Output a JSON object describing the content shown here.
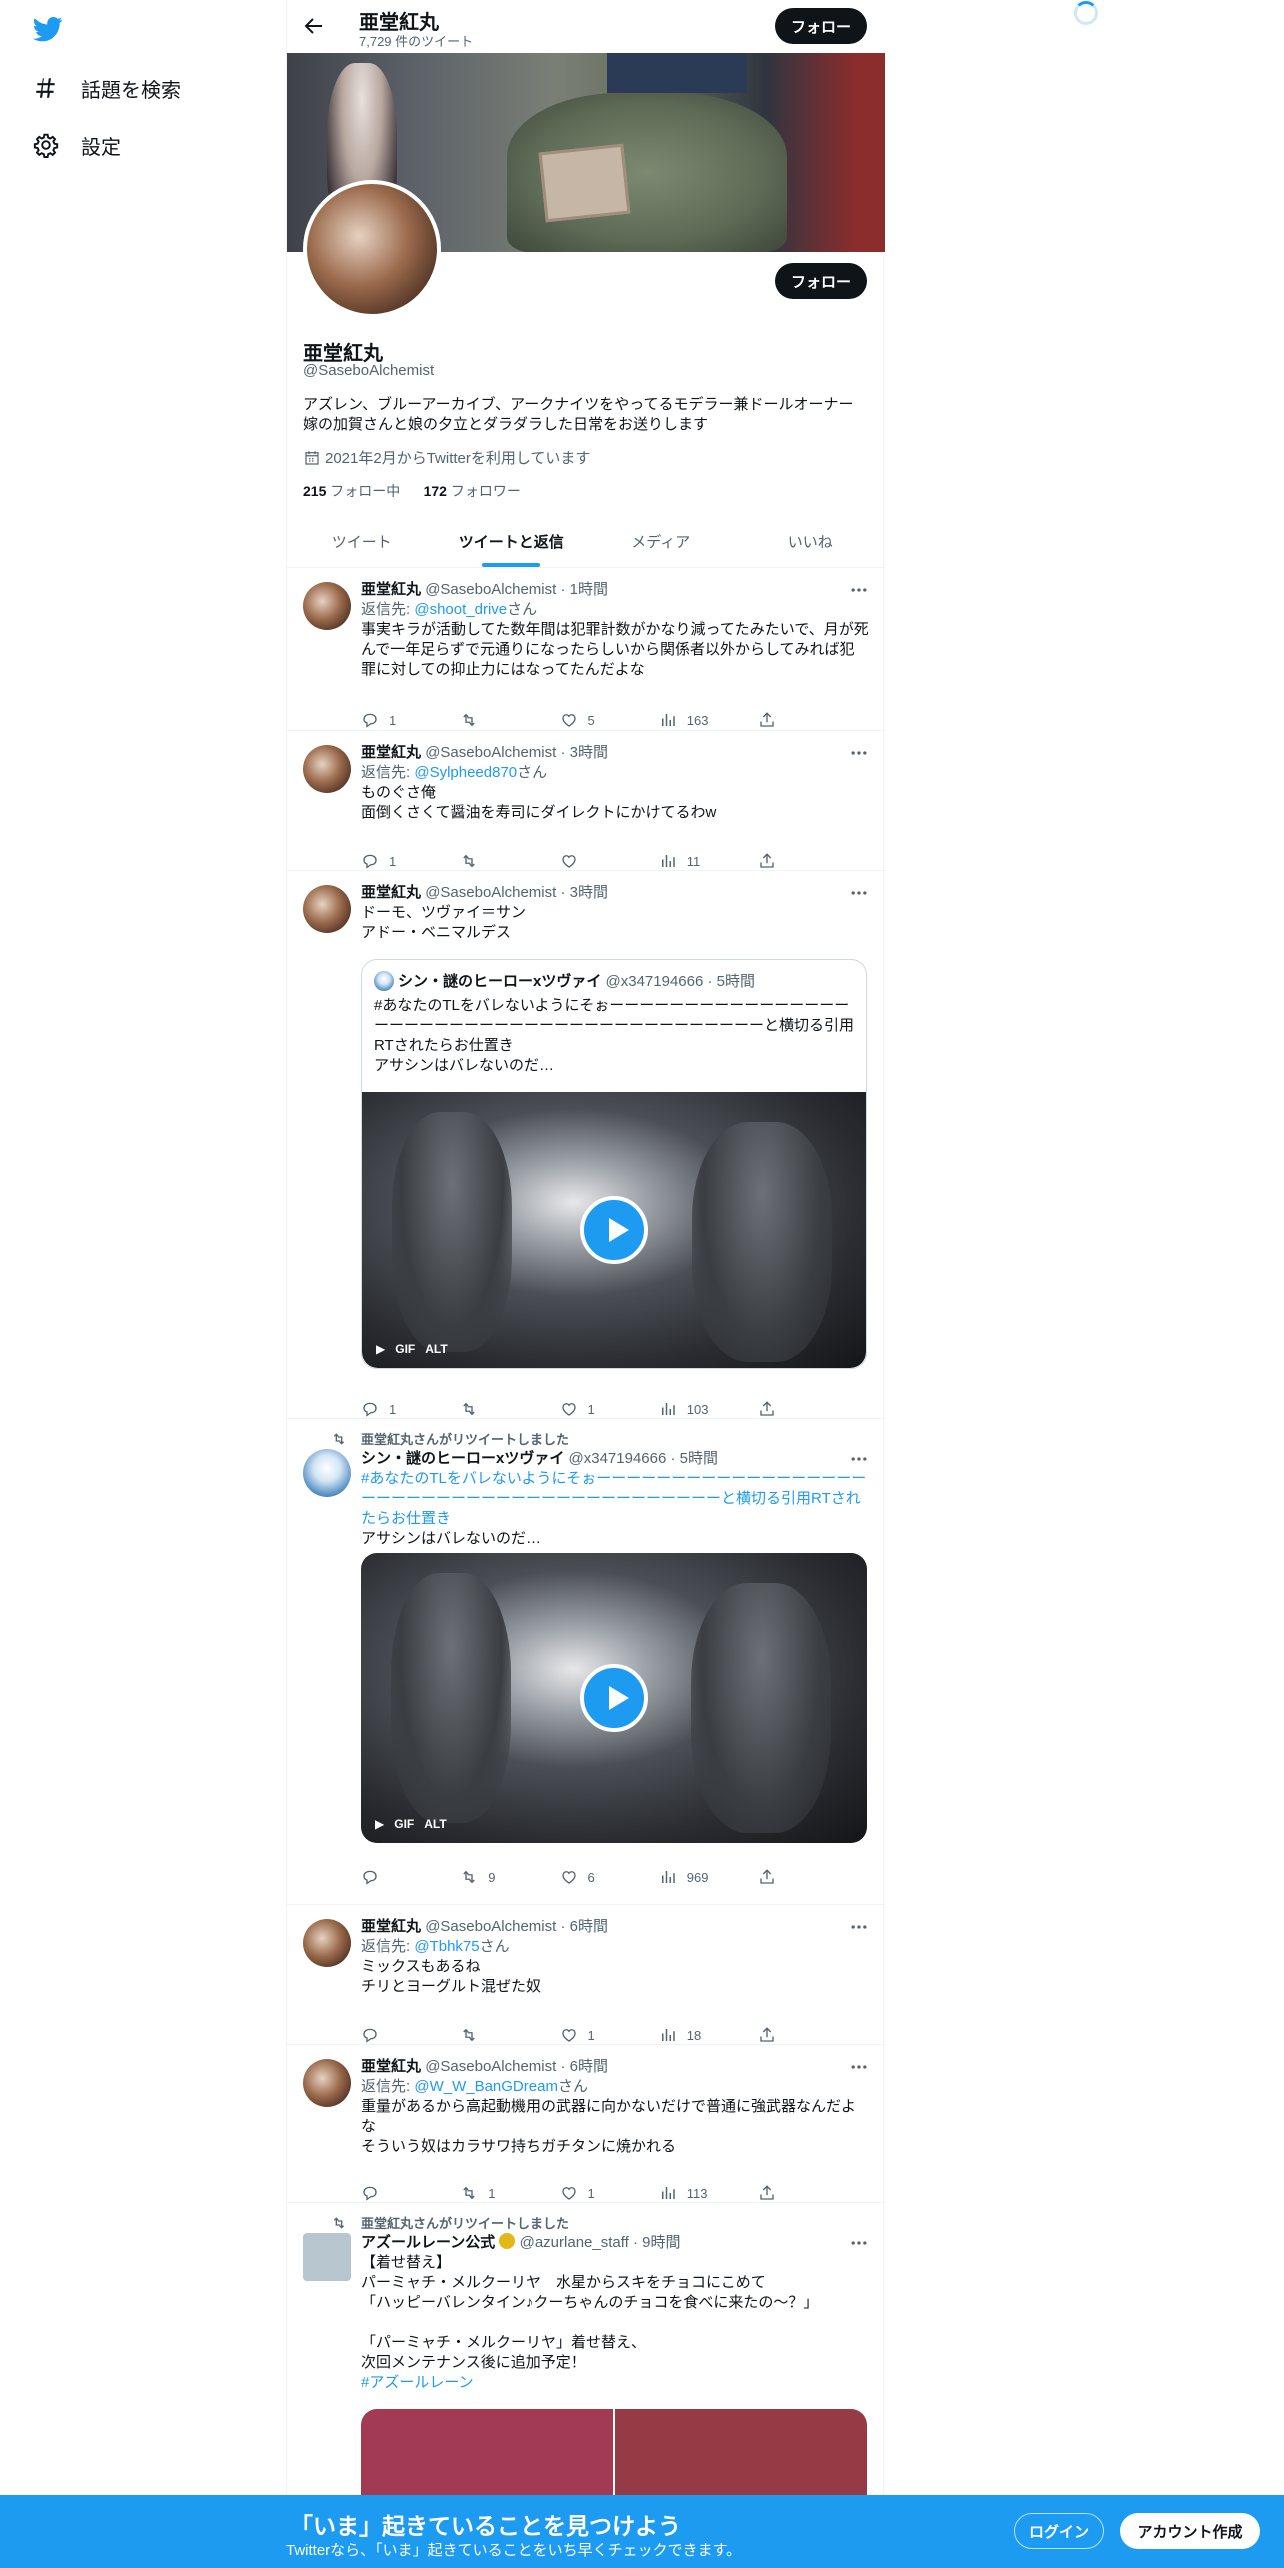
{
  "nav": {
    "explore_label": "話題を検索",
    "settings_label": "設定"
  },
  "header": {
    "name": "亜堂紅丸",
    "tweet_count": "7,729 件のツイート",
    "follow_label": "フォロー"
  },
  "profile": {
    "name": "亜堂紅丸",
    "handle": "@SaseboAlchemist",
    "bio": "アズレン、ブルーアーカイブ、アークナイツをやってるモデラー兼ドールオーナー 嫁の加賀さんと娘の夕立とダラダラした日常をお送りします",
    "joined": "2021年2月からTwitterを利用しています",
    "following_count": "215",
    "following_label": "フォロー中",
    "followers_count": "172",
    "followers_label": "フォロワー",
    "follow_label": "フォロー"
  },
  "tabs": [
    "ツイート",
    "ツイートと返信",
    "メディア",
    "いいね"
  ],
  "tweets": [
    {
      "name": "亜堂紅丸",
      "meta": "@SaseboAlchemist · 1時間",
      "reply_prefix": "返信先: ",
      "reply_to": "@shoot_drive",
      "reply_suffix": "さん",
      "text": "事実キラが活動してた数年間は犯罪計数がかなり減ってたみたいで、月が死んで一年足らずで元通りになったらしいから関係者以外からしてみれば犯罪に対しての抑止力にはなってたんだよな",
      "replies": "1",
      "retweets": "",
      "likes": "5",
      "views": "163"
    },
    {
      "name": "亜堂紅丸",
      "meta": "@SaseboAlchemist · 3時間",
      "reply_prefix": "返信先: ",
      "reply_to": "@Sylpheed870",
      "reply_suffix": "さん",
      "text": "ものぐさ俺\n面倒くさくて醤油を寿司にダイレクトにかけてるわw",
      "replies": "1",
      "retweets": "",
      "likes": "",
      "views": "11"
    },
    {
      "name": "亜堂紅丸",
      "meta": "@SaseboAlchemist · 3時間",
      "text": "ドーモ、ツヴァイ＝サン\nアドー・ベニマルデス",
      "quote": {
        "name": "シン・謎のヒーローxツヴァイ",
        "meta": "@x347194666 · 5時間",
        "text": "#あなたのTLをバレないようにそぉーーーーーーーーーーーーーーーーーーーーーーーーーーーーーーーーーーーーーーーーーーと横切る引用RTされたらお仕置き\nアサシンはバレないのだ…",
        "gif": "GIF",
        "alt": "ALT"
      },
      "replies": "1",
      "retweets": "",
      "likes": "1",
      "views": "103"
    },
    {
      "retweeted_by": "亜堂紅丸さんがリツイートしました",
      "name": "シン・謎のヒーローxツヴァイ",
      "meta": "@x347194666 · 5時間",
      "hashtag_text": "#あなたのTLをバレないようにそぉーーーーーーーーーーーーーーーーーーーーーーーーーーーーーーーーーーーーーーーーーーと横切る引用RTされたらお仕置き",
      "text": "アサシンはバレないのだ…",
      "gif": "GIF",
      "alt": "ALT",
      "replies": "",
      "retweets": "9",
      "likes": "6",
      "views": "969"
    },
    {
      "name": "亜堂紅丸",
      "meta": "@SaseboAlchemist · 6時間",
      "reply_prefix": "返信先: ",
      "reply_to": "@Tbhk75",
      "reply_suffix": "さん",
      "text": "ミックスもあるね\nチリとヨーグルト混ぜた奴",
      "replies": "",
      "retweets": "",
      "likes": "1",
      "views": "18"
    },
    {
      "name": "亜堂紅丸",
      "meta": "@SaseboAlchemist · 6時間",
      "reply_prefix": "返信先: ",
      "reply_to": "@W_W_BanGDream",
      "reply_suffix": "さん",
      "text": "重量があるから高起動機用の武器に向かないだけで普通に強武器なんだよな\nそういう奴はカラサワ持ちガチタンに焼かれる",
      "replies": "",
      "retweets": "1",
      "likes": "1",
      "views": "113"
    },
    {
      "retweeted_by": "亜堂紅丸さんがリツイートしました",
      "name": "アズールレーン公式",
      "meta": "@azurlane_staff · 9時間",
      "text": "【着せ替え】\nパーミャチ・メルクーリヤ　水星からスキをチョコにこめて\n「ハッピーバレンタイン♪クーちゃんのチョコを食べに来たの～？」\n\n「パーミャチ・メルクーリヤ」着せ替え、\n次回メンテナンス後に追加予定！",
      "hashtag": "#アズールレーン"
    }
  ],
  "bottom_bar": {
    "title": "「いま」起きていることを見つけよう",
    "subtitle": "Twitterなら、「いま」起きていることをいち早くチェックできます。",
    "login_label": "ログイン",
    "signup_label": "アカウント作成"
  },
  "colors": {
    "accent": "#1d9bf0",
    "text": "#0f1419",
    "secondary": "#536471"
  }
}
